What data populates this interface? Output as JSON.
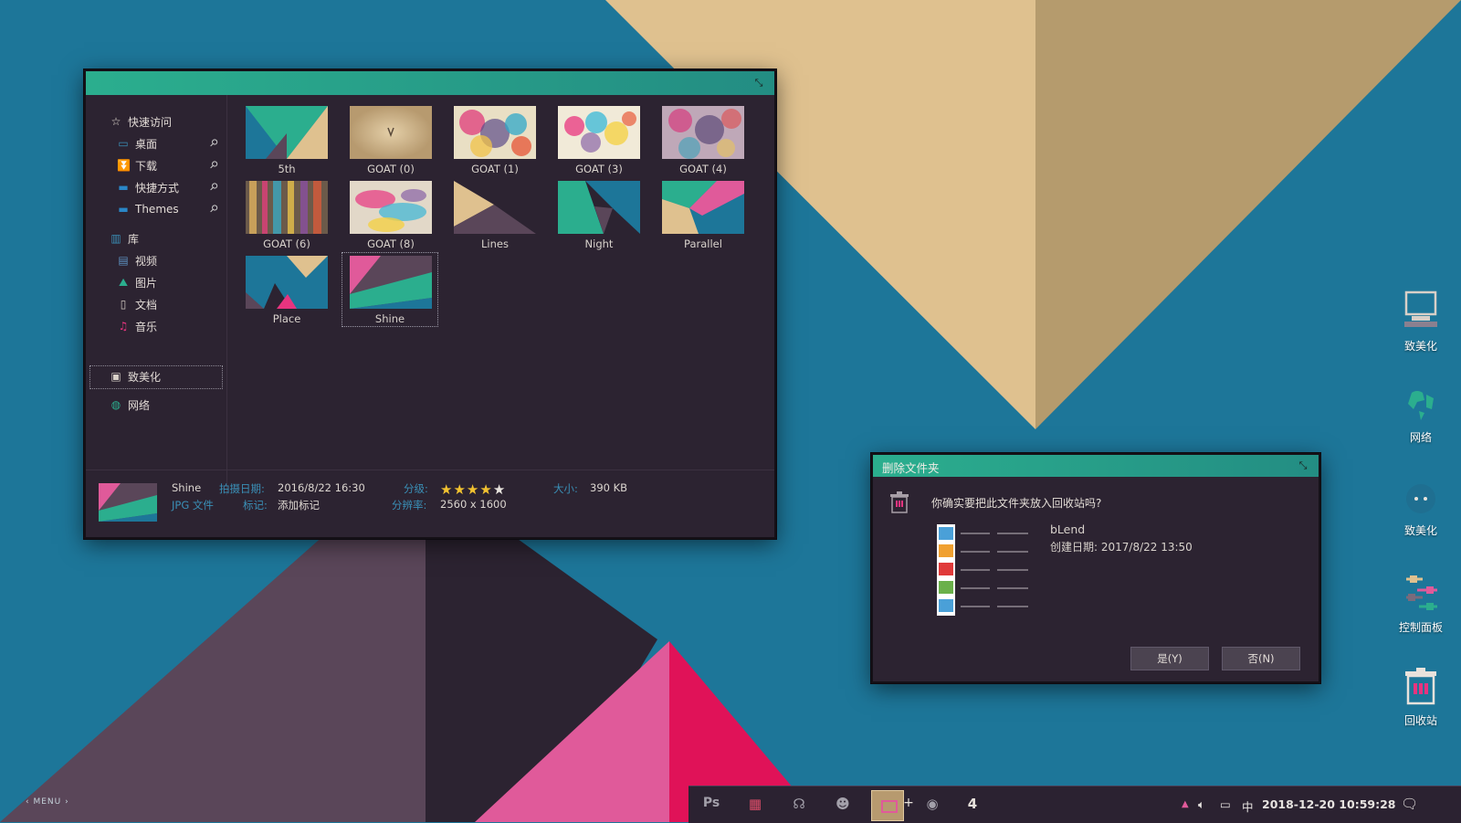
{
  "explorer": {
    "sidebar": {
      "quick_access": "快速访问",
      "desktop": "桌面",
      "downloads": "下载",
      "shortcuts": "快捷方式",
      "themes": "Themes",
      "library": "库",
      "videos": "视频",
      "pictures": "图片",
      "documents": "文档",
      "music": "音乐",
      "beautify": "致美化",
      "network": "网络"
    },
    "files": [
      "5th",
      "GOAT (0)",
      "GOAT (1)",
      "GOAT (3)",
      "GOAT (4)",
      "GOAT (6)",
      "GOAT (8)",
      "Lines",
      "Night",
      "Parallel",
      "Place",
      "Shine"
    ],
    "selected_file": "Shine",
    "status": {
      "name": "Shine",
      "type": "JPG 文件",
      "date_label": "拍摄日期:",
      "date_value": "2016/8/22 16:30",
      "tag_label": "标记:",
      "tag_value": "添加标记",
      "rating_label": "分级:",
      "rating": 4,
      "rating_max": 5,
      "resolution_label": "分辨率:",
      "resolution_value": "2560 x 1600",
      "size_label": "大小:",
      "size_value": "390 KB"
    }
  },
  "dialog": {
    "title": "删除文件夹",
    "question": "你确实要把此文件夹放入回收站吗?",
    "folder_name": "bLend",
    "created": "创建日期: 2017/8/22 13:50",
    "yes": "是(Y)",
    "no": "否(N)"
  },
  "desktop_icons": [
    "致美化",
    "网络",
    "致美化",
    "控制面板",
    "回收站"
  ],
  "taskbar": {
    "menu": "‹ MENU ›",
    "ps": "Ps",
    "plus": "+",
    "four": "4",
    "ime": "中",
    "datetime": "2018-12-20  10:59:28"
  },
  "colors": {
    "teal": "#2bae8e",
    "dark": "#2c2331",
    "blue": "#1d7699",
    "tan": "#dfc18f",
    "pink": "#e8347f",
    "accent_blue": "#3a8fb6"
  }
}
